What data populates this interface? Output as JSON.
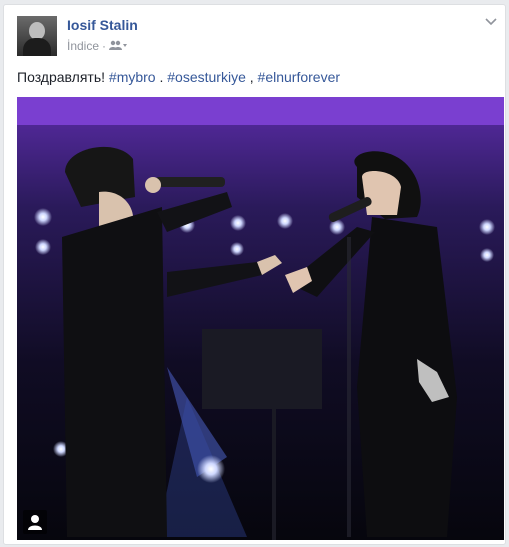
{
  "post": {
    "author": "Iosif Stalin",
    "time": "İndice",
    "separator": "·",
    "audience_icon": "friends-icon",
    "message_text": "Поздравлять!",
    "hashtags": [
      "#mybro",
      ".",
      "#osesturkiye",
      ",",
      "#elnurforever"
    ]
  },
  "photo": {
    "description": "",
    "user_badge_icon": "person-icon"
  },
  "colors": {
    "link": "#365899",
    "text": "#1d2129",
    "muted": "#90949c"
  }
}
